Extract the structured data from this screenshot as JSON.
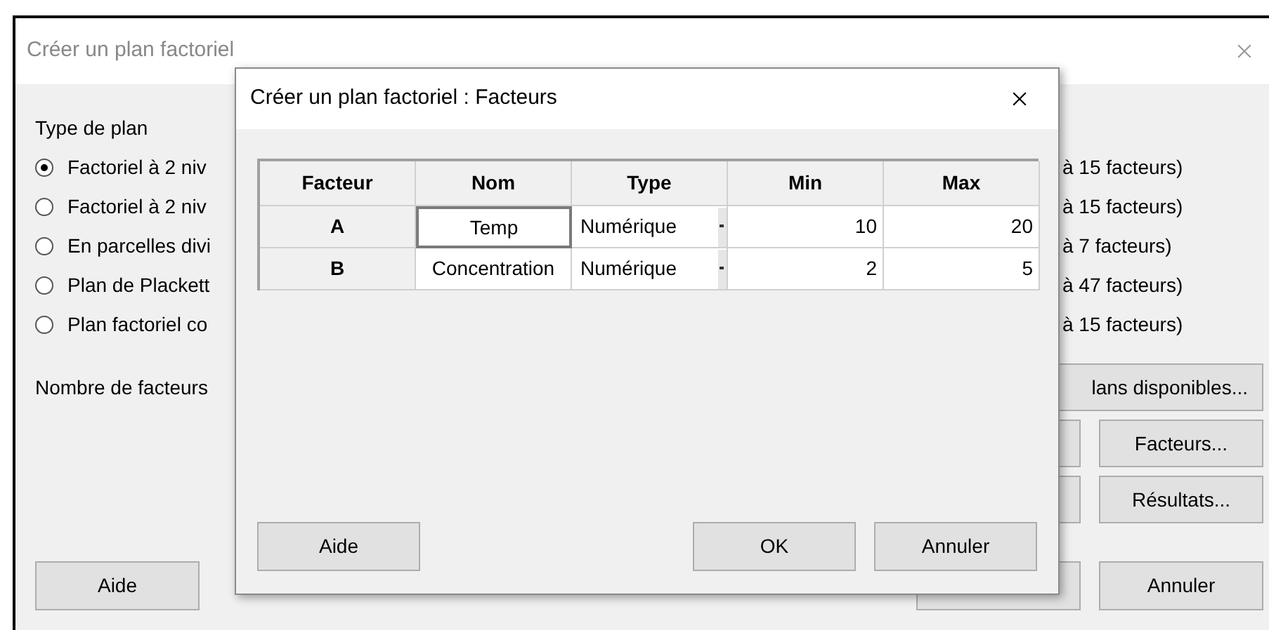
{
  "main_window": {
    "title": "Créer un plan factoriel",
    "section_label": "Type de plan",
    "plan_types": [
      {
        "label": "Factoriel à 2 niv",
        "range": "à 15 facteurs)",
        "selected": true
      },
      {
        "label": "Factoriel à 2 niv",
        "range": "à 15 facteurs)",
        "selected": false
      },
      {
        "label": "En parcelles divi",
        "range": "à 7 facteurs)",
        "selected": false
      },
      {
        "label": "Plan de Plackett",
        "range": "à 47 facteurs)",
        "selected": false
      },
      {
        "label": "Plan factoriel co",
        "range": "à 15 facteurs)",
        "selected": false
      }
    ],
    "factor_count_label": "Nombre de facteurs",
    "buttons": {
      "available_designs": "lans disponibles...",
      "factors": "Facteurs...",
      "results": "Résultats...",
      "help": "Aide",
      "cancel": "Annuler"
    }
  },
  "dialog": {
    "title": "Créer un plan factoriel : Facteurs",
    "columns": [
      "Facteur",
      "Nom",
      "Type",
      "Min",
      "Max"
    ],
    "rows": [
      {
        "factor": "A",
        "name": "Temp",
        "type": "Numérique",
        "min": "10",
        "max": "20",
        "editing": true
      },
      {
        "factor": "B",
        "name": "Concentration",
        "type": "Numérique",
        "min": "2",
        "max": "5",
        "editing": false
      }
    ],
    "buttons": {
      "help": "Aide",
      "ok": "OK",
      "cancel": "Annuler"
    }
  }
}
